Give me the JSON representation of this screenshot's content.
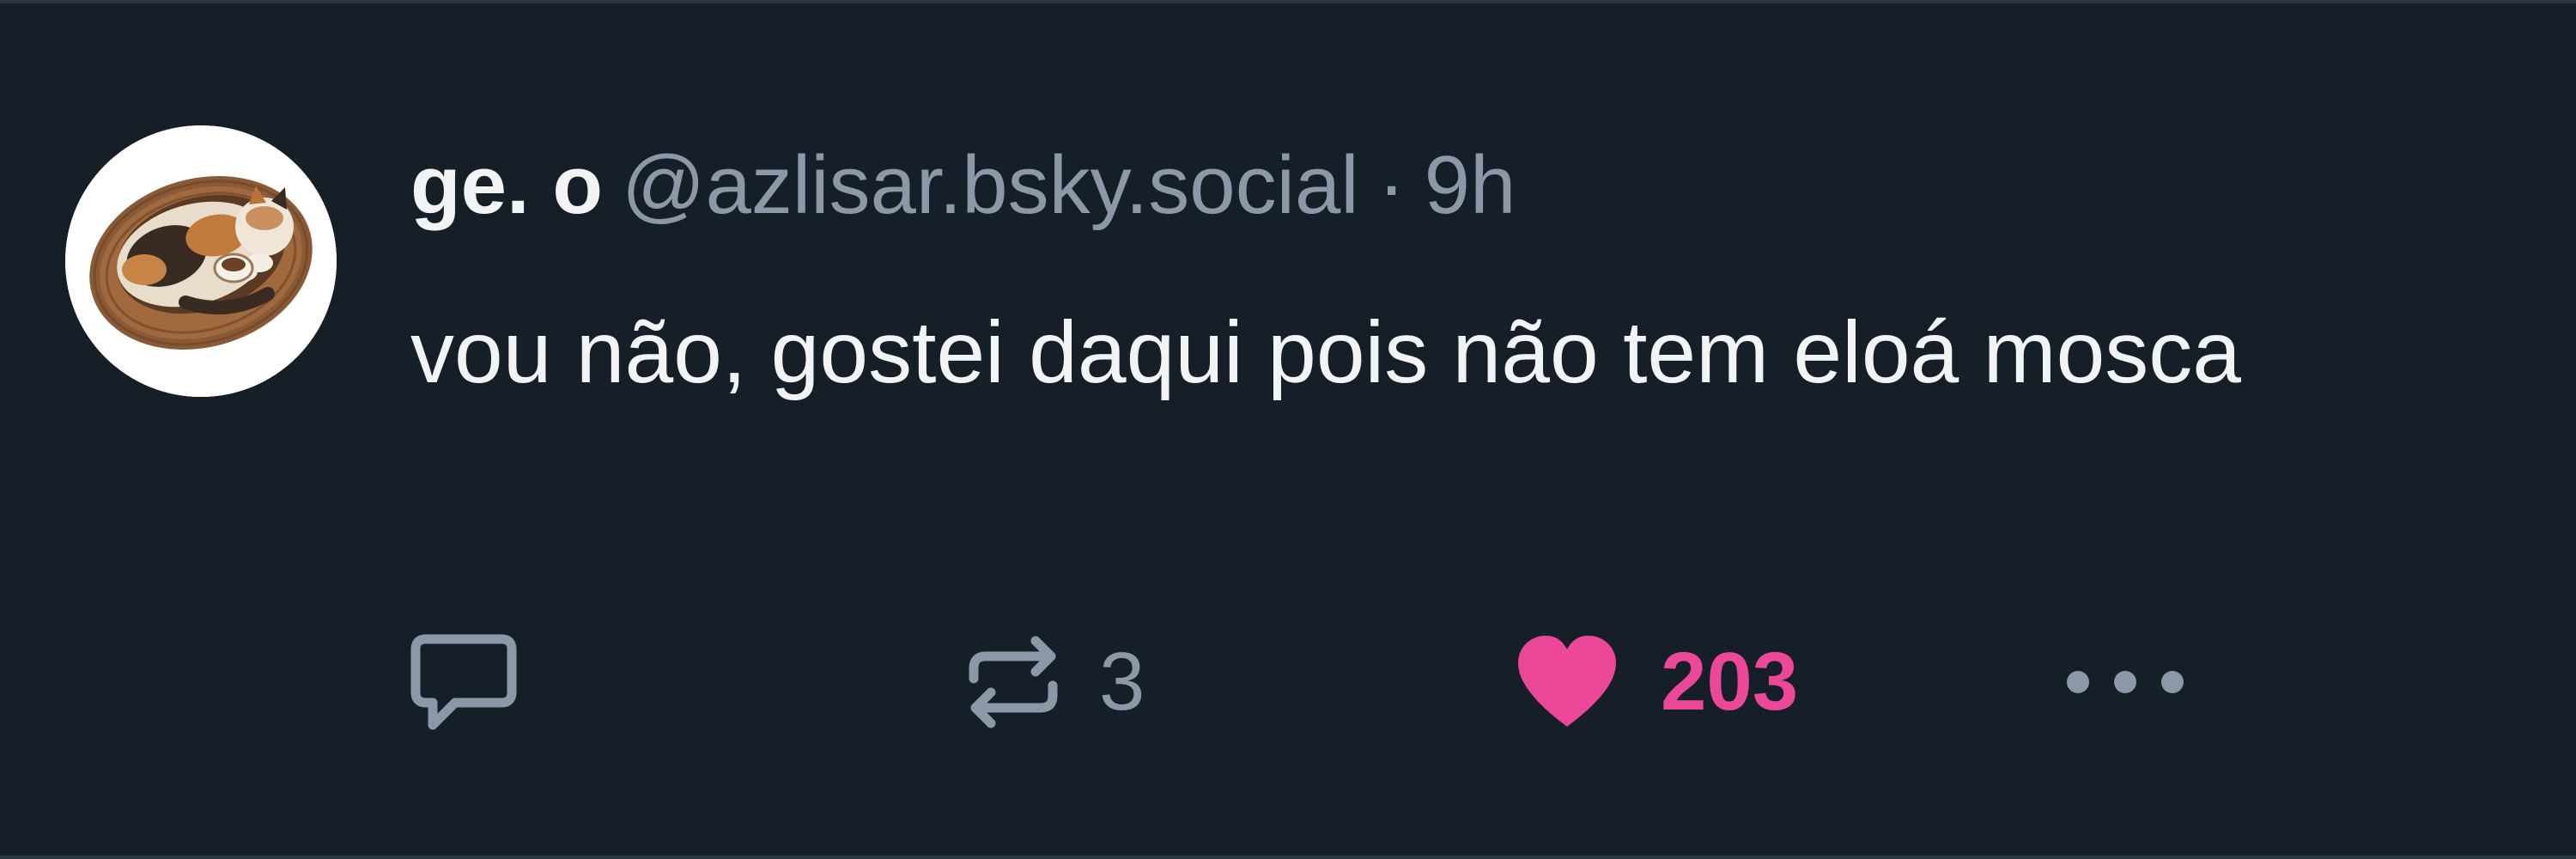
{
  "post": {
    "author": {
      "display_name": "ge. o",
      "handle": "@azlisar.bsky.social",
      "avatar_icon": "cat-in-basket-avatar"
    },
    "separator": "·",
    "time": "9h",
    "text": "vou não, gostei daqui pois não tem eloá mosca",
    "actions": {
      "reply": {
        "icon": "reply-icon"
      },
      "repost": {
        "icon": "repost-icon",
        "count": "3"
      },
      "like": {
        "icon": "heart-icon",
        "count": "203",
        "liked": true
      },
      "more": {
        "icon": "more-icon"
      }
    }
  },
  "colors": {
    "background": "#161e27",
    "text_primary": "#f1f3f5",
    "text_secondary": "#8b98a8",
    "like_accent": "#ec4899"
  }
}
